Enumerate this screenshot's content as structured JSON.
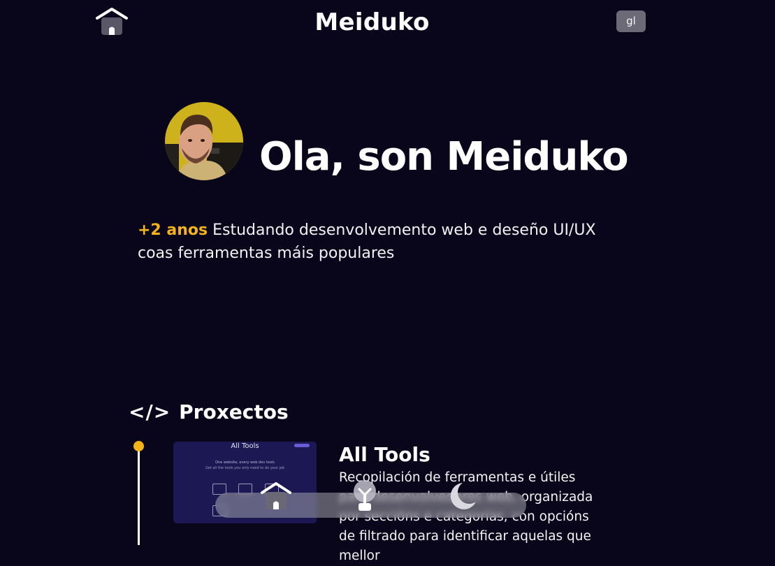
{
  "header": {
    "title": "Meiduko",
    "language_label": "gl"
  },
  "hero": {
    "greeting": "Ola, son Meiduko",
    "intro_highlight": "+2 anos",
    "intro_text": " Estudando desenvolvemento web e deseño UI/UX coas ferramentas máis populares"
  },
  "projects": {
    "section_icon_text": "</>",
    "section_title": "Proxectos",
    "items": [
      {
        "title": "All Tools",
        "description": "Recopilación de ferramentas e útiles para desenvolvedores web, organizada por seccións e categorías, con opcións de filtrado para identificar aquelas que mellor",
        "thumbnail": {
          "title": "All Tools",
          "line1": "One website, every web dev tools",
          "line2": "Get all the tools you only need to do your job"
        }
      }
    ]
  },
  "floating_nav": {
    "icons": [
      "home-icon",
      "lightbulb-icon",
      "moon-icon"
    ]
  },
  "colors": {
    "background": "#09051a",
    "accent": "#f3b319",
    "thumbnail_bg": "#1b1854"
  }
}
